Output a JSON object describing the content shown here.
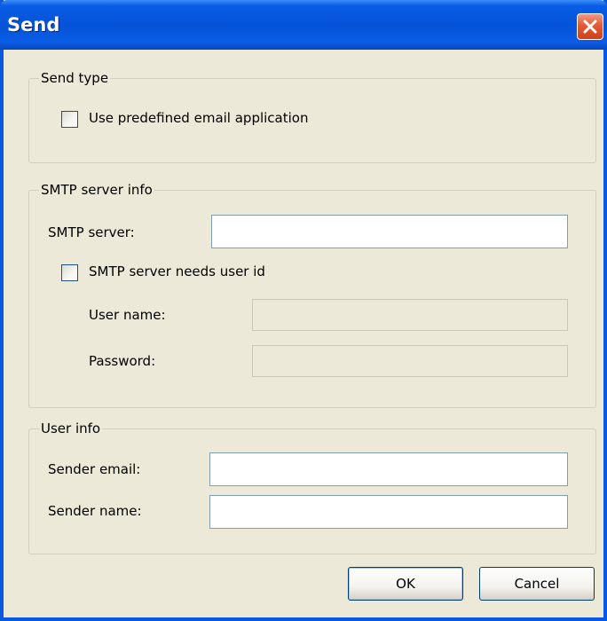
{
  "window": {
    "title": "Send"
  },
  "send_type": {
    "legend": "Send type",
    "use_predefined_label": "Use predefined email application",
    "use_predefined_checked": false
  },
  "smtp": {
    "legend": "SMTP server info",
    "server_label": "SMTP server:",
    "server_value": "",
    "needs_user_id_label": "SMTP server needs user id",
    "needs_user_id_checked": false,
    "username_label": "User name:",
    "username_value": "",
    "password_label": "Password:",
    "password_value": ""
  },
  "user_info": {
    "legend": "User info",
    "sender_email_label": "Sender email:",
    "sender_email_value": "",
    "sender_name_label": "Sender name:",
    "sender_name_value": ""
  },
  "buttons": {
    "ok_label": "OK",
    "cancel_label": "Cancel"
  },
  "colors": {
    "title_bar": "#0553d8",
    "dialog_background": "#ece9d8",
    "close_button": "#e35a36"
  }
}
